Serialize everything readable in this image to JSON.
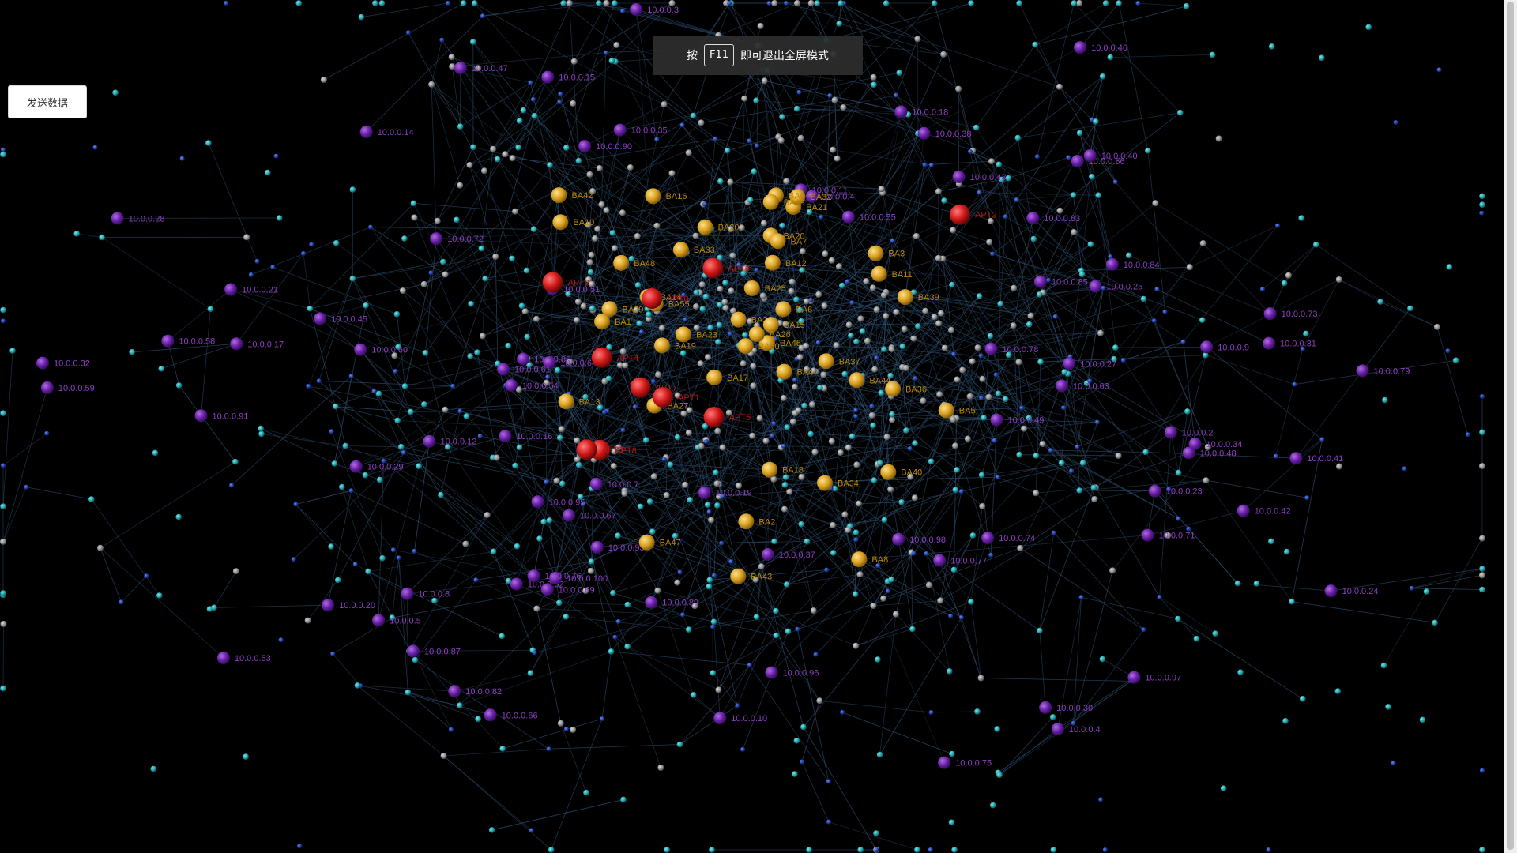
{
  "controls": {
    "send_label": "发送数据"
  },
  "fullscreen_hint": {
    "prefix": "按",
    "key": "F11",
    "suffix": "即可退出全屏模式"
  },
  "colors": {
    "background": "#000000",
    "edge": "#2a4a6a",
    "host": "#6a1fa8",
    "host_label": "#8a3fc0",
    "ba": "#d8a020",
    "ba_label": "#b8860b",
    "apt": "#d01818",
    "apt_label": "#b01818",
    "teal": "#1fa0a8",
    "gray": "#8a8a8a",
    "blue": "#1c3fa8"
  },
  "graph": {
    "hosts": [
      "10.0.0.23",
      "10.0.0.73",
      "10.0.0.86",
      "10.0.0.15",
      "10.0.0.27",
      "10.0.0.89",
      "10.0.0.62",
      "10.0.0.49",
      "10.0.0.83",
      "10.0.0.12",
      "10.0.0.2",
      "10.0.0.75",
      "10.0.0.78",
      "10.0.0.8",
      "10.0.0.96",
      "10.0.0.7",
      "10.0.0.37",
      "10.0.0.59",
      "10.0.0.4",
      "10.0.0.18",
      "10.0.0.54",
      "10.0.0.21",
      "10.0.0.47",
      "10.0.0.9",
      "10.0.0.31",
      "10.0.0.60",
      "10.0.0.97",
      "10.0.0.71",
      "10.0.0.34",
      "10.0.0.42",
      "10.0.0.20",
      "10.0.0.55",
      "10.0.0.28",
      "10.0.0.74",
      "10.0.0.63",
      "10.0.0.30",
      "10.0.0.77",
      "10.0.0.79",
      "10.0.0.84",
      "10.0.0.19",
      "10.0.0.98",
      "10.0.0.16",
      "10.0.0.29",
      "10.0.0.4",
      "10.0.0.17",
      "10.0.0.58",
      "10.0.0.95",
      "10.0.0.46",
      "10.0.0.67",
      "10.0.0.100",
      "10.0.0.3",
      "10.0.0.51",
      "10.0.0.45",
      "10.0.0.82",
      "10.0.0.93",
      "10.0.0.56",
      "10.0.0.85",
      "10.0.0.43",
      "10.0.0.5",
      "10.0.0.11",
      "10.0.0.66",
      "10.0.0.40",
      "10.0.0.32",
      "10.0.0.76",
      "10.0.0.14",
      "10.0.0.87",
      "10.0.0.41",
      "10.0.0.25",
      "10.0.0.53",
      "10.0.0.72",
      "10.0.0.90",
      "10.0.0.48",
      "10.0.0.10",
      "10.0.0.24",
      "10.0.0.69",
      "10.0.0.35",
      "10.0.0.64",
      "10.0.0.61",
      "10.0.0.91",
      "10.0.0.38"
    ],
    "ba": [
      "BA10",
      "BA8",
      "BA20",
      "BA39",
      "BA5",
      "BA34",
      "BA21",
      "BA3",
      "BA47",
      "BA46",
      "BA14",
      "BA37",
      "BA32",
      "BA22",
      "BA18",
      "BA42",
      "BA29",
      "BA7",
      "BA20",
      "BA16",
      "BA2",
      "BA15",
      "BA0",
      "BA23",
      "BA33",
      "BA6",
      "BA12",
      "BA13",
      "BA55",
      "BA43",
      "BA49",
      "BA1",
      "BA27",
      "BA48",
      "BA50",
      "BA17",
      "BA40",
      "BA44",
      "BA4",
      "BA26",
      "BA11",
      "BA19",
      "BA36",
      "BA25"
    ],
    "apt": [
      "APT7",
      "APT8",
      "APT4",
      "APT6",
      "APT0",
      "APT9",
      "APT5",
      "APT1",
      "APT2",
      "APT3"
    ]
  }
}
